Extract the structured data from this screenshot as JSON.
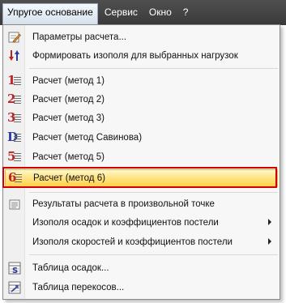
{
  "menubar": {
    "items": [
      {
        "label": "Упругое основание",
        "active": true
      },
      {
        "label": "Сервис",
        "active": false
      },
      {
        "label": "Окно",
        "active": false
      },
      {
        "label": "?",
        "active": false
      }
    ]
  },
  "menu": {
    "items": [
      {
        "label": "Параметры расчета...",
        "icon": "settings-pencil-icon"
      },
      {
        "label": "Формировать изополя для выбранных нагрузок",
        "icon": "sort-arrows-icon"
      },
      {
        "label": "Расчет (метод 1)",
        "icon": "method-1-icon",
        "digit": "1"
      },
      {
        "label": "Расчет (метод 2)",
        "icon": "method-2-icon",
        "digit": "2"
      },
      {
        "label": "Расчет (метод 3)",
        "icon": "method-3-icon",
        "digit": "3"
      },
      {
        "label": "Расчет (метод Савинова)",
        "icon": "method-savinov-icon",
        "digit": "D"
      },
      {
        "label": "Расчет (метод 5)",
        "icon": "method-5-icon",
        "digit": "5"
      },
      {
        "label": "Расчет (метод 6)",
        "icon": "method-6-icon",
        "digit": "6",
        "highlighted": true
      },
      {
        "label": "Результаты расчета в произвольной точке",
        "icon": "point-results-icon"
      },
      {
        "label": "Изополя осадок и коэффициентов постели",
        "icon": "",
        "submenu": true
      },
      {
        "label": "Изополя скоростей и коэффициентов постели",
        "icon": "",
        "submenu": true
      },
      {
        "label": "Таблица осадок...",
        "icon": "table-s-icon"
      },
      {
        "label": "Таблица перекосов...",
        "icon": "table-skew-icon"
      }
    ]
  },
  "colors": {
    "menubar_bg": "#454545",
    "highlight": "#ffe07a",
    "highlight_border": "#d40000",
    "digit_red": "#c21f1f",
    "digit_blue": "#2a3c9c"
  }
}
